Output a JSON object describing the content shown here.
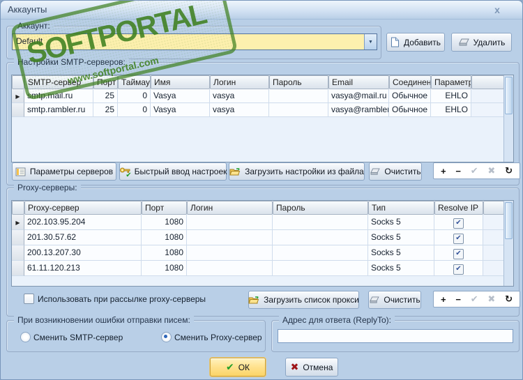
{
  "window": {
    "title": "Аккаунты"
  },
  "watermark": {
    "brand": "SOFTPORTAL",
    "tm": "™",
    "url": "www.softportal.com",
    "color": "#3e801f"
  },
  "account": {
    "group_label": "Аккаунт:",
    "selected": "Default",
    "add_label": "Добавить",
    "delete_label": "Удалить"
  },
  "smtp": {
    "group_label": "Настройки SMTP-серверов:",
    "columns": {
      "server": "SMTP-сервер",
      "port": "Порт",
      "timeout": "Таймаут",
      "name": "Имя",
      "login": "Логин",
      "password": "Пароль",
      "email": "Email",
      "connection": "Соединение",
      "param": "Параметр"
    },
    "rows": [
      {
        "server": "smtp.mail.ru",
        "port": "25",
        "timeout": "0",
        "name": "Vasya",
        "login": "vasya",
        "password": "",
        "email": "vasya@mail.ru",
        "connection": "Обычное",
        "param": "EHLO"
      },
      {
        "server": "smtp.rambler.ru",
        "port": "25",
        "timeout": "0",
        "name": "Vasya",
        "login": "vasya",
        "password": "",
        "email": "vasya@rambler.ru",
        "connection": "Обычное",
        "param": "EHLO"
      }
    ],
    "buttons": {
      "params": "Параметры серверов",
      "quick": "Быстрый ввод настроек",
      "load": "Загрузить настройки из файла",
      "clear": "Очистить"
    }
  },
  "proxy": {
    "group_label": "Proxy-серверы:",
    "columns": {
      "server": "Proxy-сервер",
      "port": "Порт",
      "login": "Логин",
      "password": "Пароль",
      "type": "Тип",
      "resolve": "Resolve IP"
    },
    "rows": [
      {
        "server": "202.103.95.204",
        "port": "1080",
        "login": "",
        "password": "",
        "type": "Socks 5",
        "resolve_ip": true
      },
      {
        "server": "201.30.57.62",
        "port": "1080",
        "login": "",
        "password": "",
        "type": "Socks 5",
        "resolve_ip": true
      },
      {
        "server": "200.13.207.30",
        "port": "1080",
        "login": "",
        "password": "",
        "type": "Socks 5",
        "resolve_ip": true
      },
      {
        "server": "61.11.120.213",
        "port": "1080",
        "login": "",
        "password": "",
        "type": "Socks 5",
        "resolve_ip": true
      }
    ],
    "use_checkbox": {
      "label": "Использовать при рассылке proxy-серверы",
      "checked": false
    },
    "buttons": {
      "load": "Загрузить список прокси",
      "clear": "Очистить"
    }
  },
  "error_action": {
    "group_label": "При возникновении ошибки отправки писем:",
    "options": [
      {
        "label": "Сменить SMTP-сервер",
        "selected": false
      },
      {
        "label": "Сменить Proxy-сервер",
        "selected": true
      }
    ]
  },
  "reply_to": {
    "group_label": "Адрес для ответа (ReplyTo):",
    "value": ""
  },
  "footer": {
    "ok_label": "ОК",
    "cancel_label": "Отмена"
  },
  "navigator": {
    "add": "+",
    "remove": "−",
    "post": "✔",
    "cancel": "✖",
    "refresh": "↻"
  },
  "icons": {
    "close": "x",
    "dropdown": "▼",
    "row_arrow": "▶",
    "check": "✔"
  },
  "colors": {
    "combo_yellow": "#fdf0ae",
    "ok_yellow": "#ffe392",
    "stamp_green": "#3e801f"
  }
}
